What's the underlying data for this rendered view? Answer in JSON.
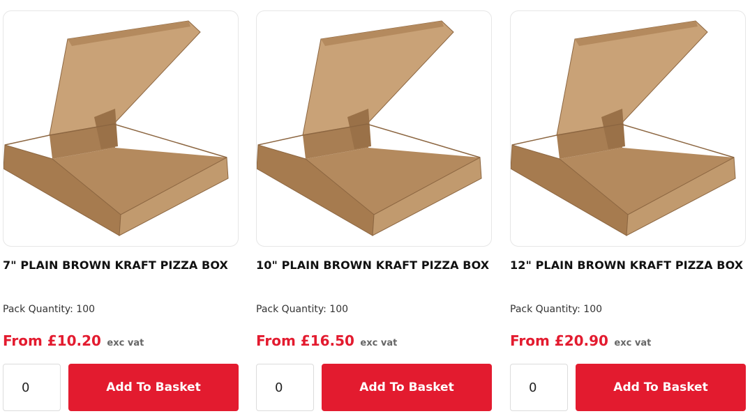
{
  "products": [
    {
      "title": "7\" PLAIN BROWN KRAFT PIZZA BOX",
      "pack_quantity": "Pack Quantity: 100",
      "price": "From £10.20",
      "vat_note": "exc vat",
      "quantity_value": "0",
      "add_button_label": "Add To Basket",
      "image_icon": "pizza-box-image"
    },
    {
      "title": "10\" PLAIN BROWN KRAFT PIZZA BOX",
      "pack_quantity": "Pack Quantity: 100",
      "price": "From £16.50",
      "vat_note": "exc vat",
      "quantity_value": "0",
      "add_button_label": "Add To Basket",
      "image_icon": "pizza-box-image"
    },
    {
      "title": "12\" PLAIN BROWN KRAFT PIZZA BOX",
      "pack_quantity": "Pack Quantity: 100",
      "price": "From £20.90",
      "vat_note": "exc vat",
      "quantity_value": "0",
      "add_button_label": "Add To Basket",
      "image_icon": "pizza-box-image"
    }
  ],
  "colors": {
    "accent": "#e31b2f",
    "kraft_light": "#c9a277",
    "kraft_mid": "#b48a5e",
    "kraft_dark": "#8c6641"
  }
}
